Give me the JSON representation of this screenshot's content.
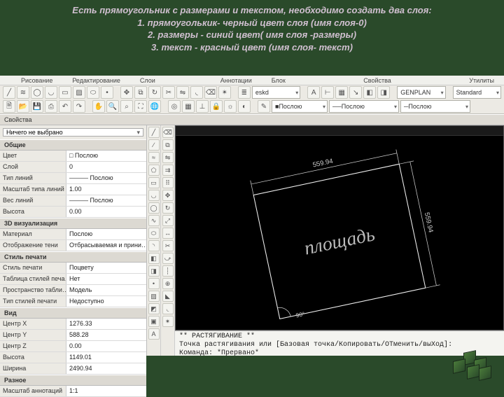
{
  "slide_header": {
    "line1": "Есть прямоугольник с размерами и текстом, необходимо создать два слоя:",
    "line2": "1. прямоуголькик- черный цвет слоя (имя слоя-0)",
    "line3": "2. размеры - синий цвет( имя слоя -размеры)",
    "line4": "3. текст - красный цвет (имя слоя- текст)"
  },
  "ribbon": {
    "tabs": [
      "Рисование",
      "Редактирование",
      "Слои",
      "",
      "Аннотации",
      "Блок",
      "",
      "Свойства",
      "",
      "Утилиты"
    ]
  },
  "toolbar2": {
    "layer_style": "eskd",
    "style1": "GENPLAN",
    "style2": "Standard",
    "color": "Послою",
    "ltype": "Послою",
    "lweight": "Послою"
  },
  "props": {
    "panel_title": "Свойства",
    "selection": "Ничего не выбрано",
    "groups": [
      {
        "title": "Общие",
        "rows": [
          {
            "k": "Цвет",
            "v": "□ Послою"
          },
          {
            "k": "Слой",
            "v": "0"
          },
          {
            "k": "Тип линий",
            "v": "——— Послою"
          },
          {
            "k": "Масштаб типа линий",
            "v": "1.00"
          },
          {
            "k": "Вес линий",
            "v": "——— Послою"
          },
          {
            "k": "Высота",
            "v": "0.00"
          }
        ]
      },
      {
        "title": "3D визуализация",
        "rows": [
          {
            "k": "Материал",
            "v": "Послою"
          },
          {
            "k": "Отображение тени",
            "v": "Отбрасываемая и прини…"
          }
        ]
      },
      {
        "title": "Стиль печати",
        "rows": [
          {
            "k": "Стиль печати",
            "v": "Поцвету"
          },
          {
            "k": "Таблица стилей печа…",
            "v": "Нет"
          },
          {
            "k": "Пространство табли…",
            "v": "Модель"
          },
          {
            "k": "Тип стилей печати",
            "v": "Недоступно"
          }
        ]
      },
      {
        "title": "Вид",
        "rows": [
          {
            "k": "Центр X",
            "v": "1276.33"
          },
          {
            "k": "Центр Y",
            "v": "588.28"
          },
          {
            "k": "Центр Z",
            "v": "0.00"
          },
          {
            "k": "Высота",
            "v": "1149.01"
          },
          {
            "k": "Ширина",
            "v": "2490.94"
          }
        ]
      },
      {
        "title": "Разное",
        "rows": [
          {
            "k": "Масштаб аннотаций",
            "v": "1:1"
          }
        ]
      }
    ]
  },
  "canvas": {
    "label_text": "площадь",
    "dim_top": "559.94",
    "dim_right": "559.94",
    "angle": "90°"
  },
  "cmd": {
    "l1": "** РАСТЯГИВАНИЕ **",
    "l2": "Точка растягивания или [Базовая точка/Копировать/ОТменить/выХод]:",
    "l3": "Команда: *Прервано*"
  }
}
